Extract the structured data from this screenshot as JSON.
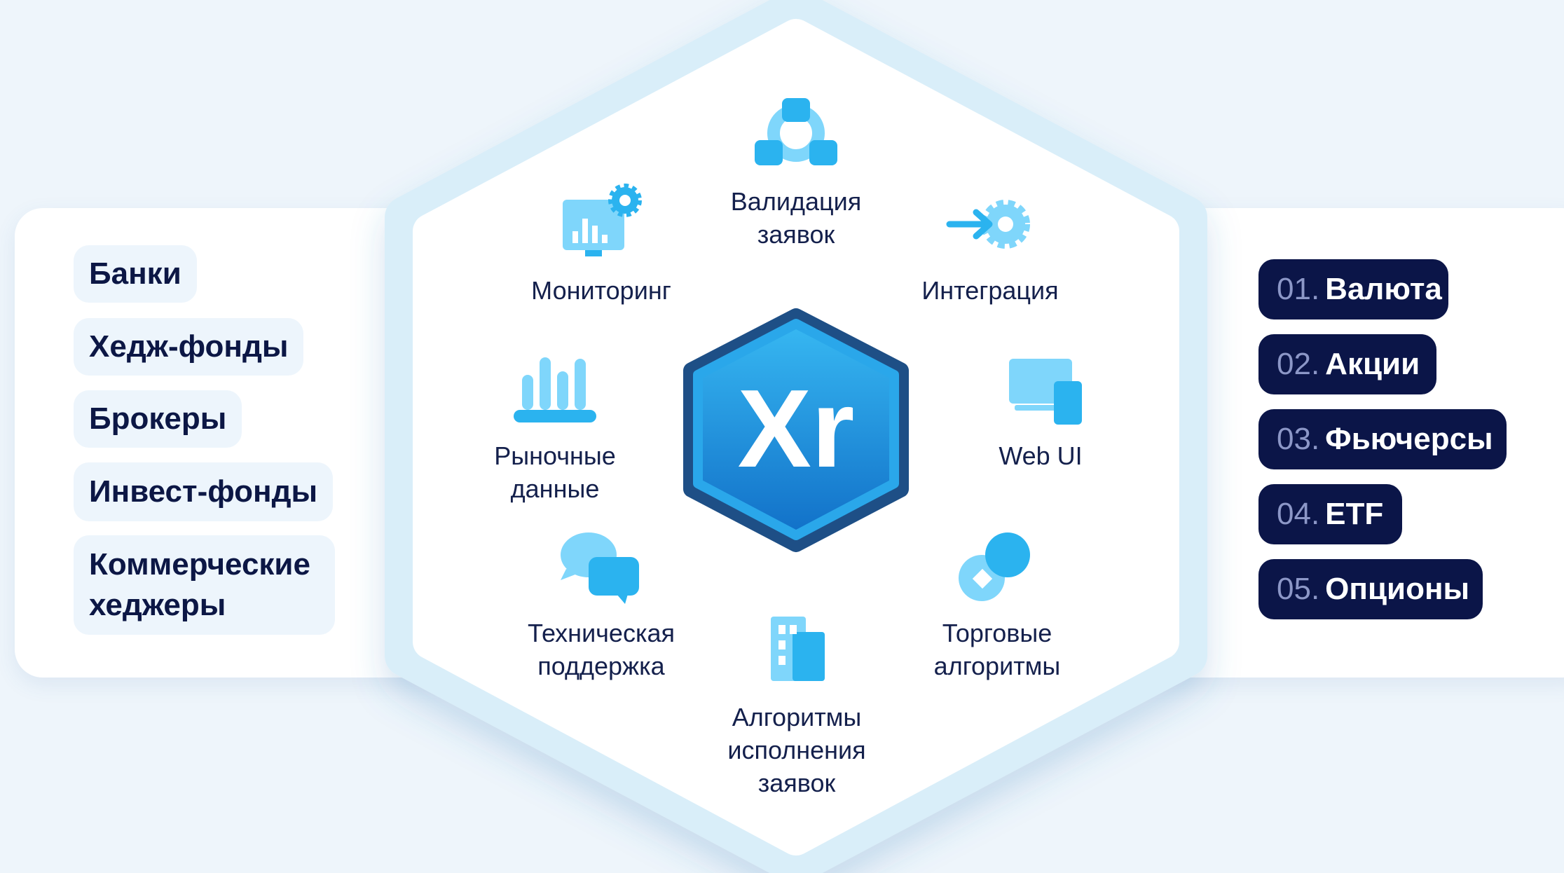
{
  "clients": [
    "Банки",
    "Хедж-фонды",
    "Брокеры",
    "Инвест-фонды",
    "Коммерческие хеджеры"
  ],
  "assets": [
    {
      "num": "01.",
      "label": "Валюта"
    },
    {
      "num": "02.",
      "label": "Акции"
    },
    {
      "num": "03.",
      "label": "Фьючерсы"
    },
    {
      "num": "04.",
      "label": "ETF"
    },
    {
      "num": "05.",
      "label": "Опционы"
    }
  ],
  "center_logo": "Xr",
  "features": {
    "validation": "Валидация заявок",
    "integration": "Интеграция",
    "monitoring": "Мониторинг",
    "market_data": "Рыночные данные",
    "web_ui": "Web UI",
    "support": "Техническая поддержка",
    "trading_algos": "Торговые алгоритмы",
    "execution_algos": "Алгоритмы исполнения заявок"
  },
  "icons": {
    "validation": "network-nodes-icon",
    "integration": "arrow-gear-icon",
    "monitoring": "monitor-chart-gear-icon",
    "market_data": "bar-chart-icon",
    "web_ui": "screens-icon",
    "support": "chat-bubbles-icon",
    "trading_algos": "circles-diamond-icon",
    "execution_algos": "building-icon"
  },
  "colors": {
    "accent_light": "#7fd6fb",
    "accent": "#2bb3ef",
    "navy": "#0b1548",
    "tag_bg": "#edf5fc",
    "hex_border": "#d9eef9"
  }
}
